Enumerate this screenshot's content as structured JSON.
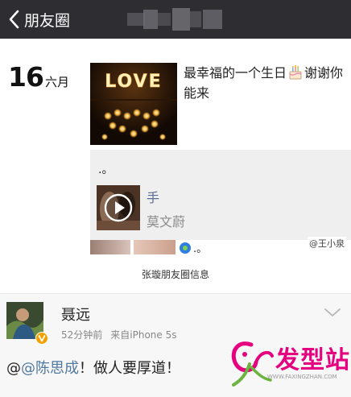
{
  "header": {
    "back_label": "朋友圈",
    "back_icon": "chevron-left-icon"
  },
  "moments": {
    "date_day": "16",
    "date_month": "六月",
    "post_text_before_icon": "最幸福的一个生日",
    "post_icon": "birthday-cake-icon",
    "post_text_after_icon": "谢谢你能来",
    "photo_text": "LOVE",
    "comment_text": ".。",
    "video": {
      "title": "手",
      "author": "莫文蔚",
      "icon": "play-icon"
    },
    "small_text": ".。",
    "watermark": "@王小泉"
  },
  "caption": "张璇朋友圈信息",
  "weibo": {
    "user_name": "聂远",
    "time": "52分钟前",
    "source": "来自iPhone 5s",
    "text_prefix": "@",
    "mention": "@陈思成",
    "text_suffix": "！做人要厚道！",
    "badge_icon": "verified-v-icon",
    "menu_icon": "chevron-down-icon"
  },
  "site": {
    "brand": "发型站",
    "url": "WWW.FAXINGZHAN.COM"
  },
  "colors": {
    "nav_bg": "#2e2e32",
    "link_blue": "#5a6d96",
    "brand_pink": "#e4007f",
    "badge_orange": "#f2a100"
  }
}
